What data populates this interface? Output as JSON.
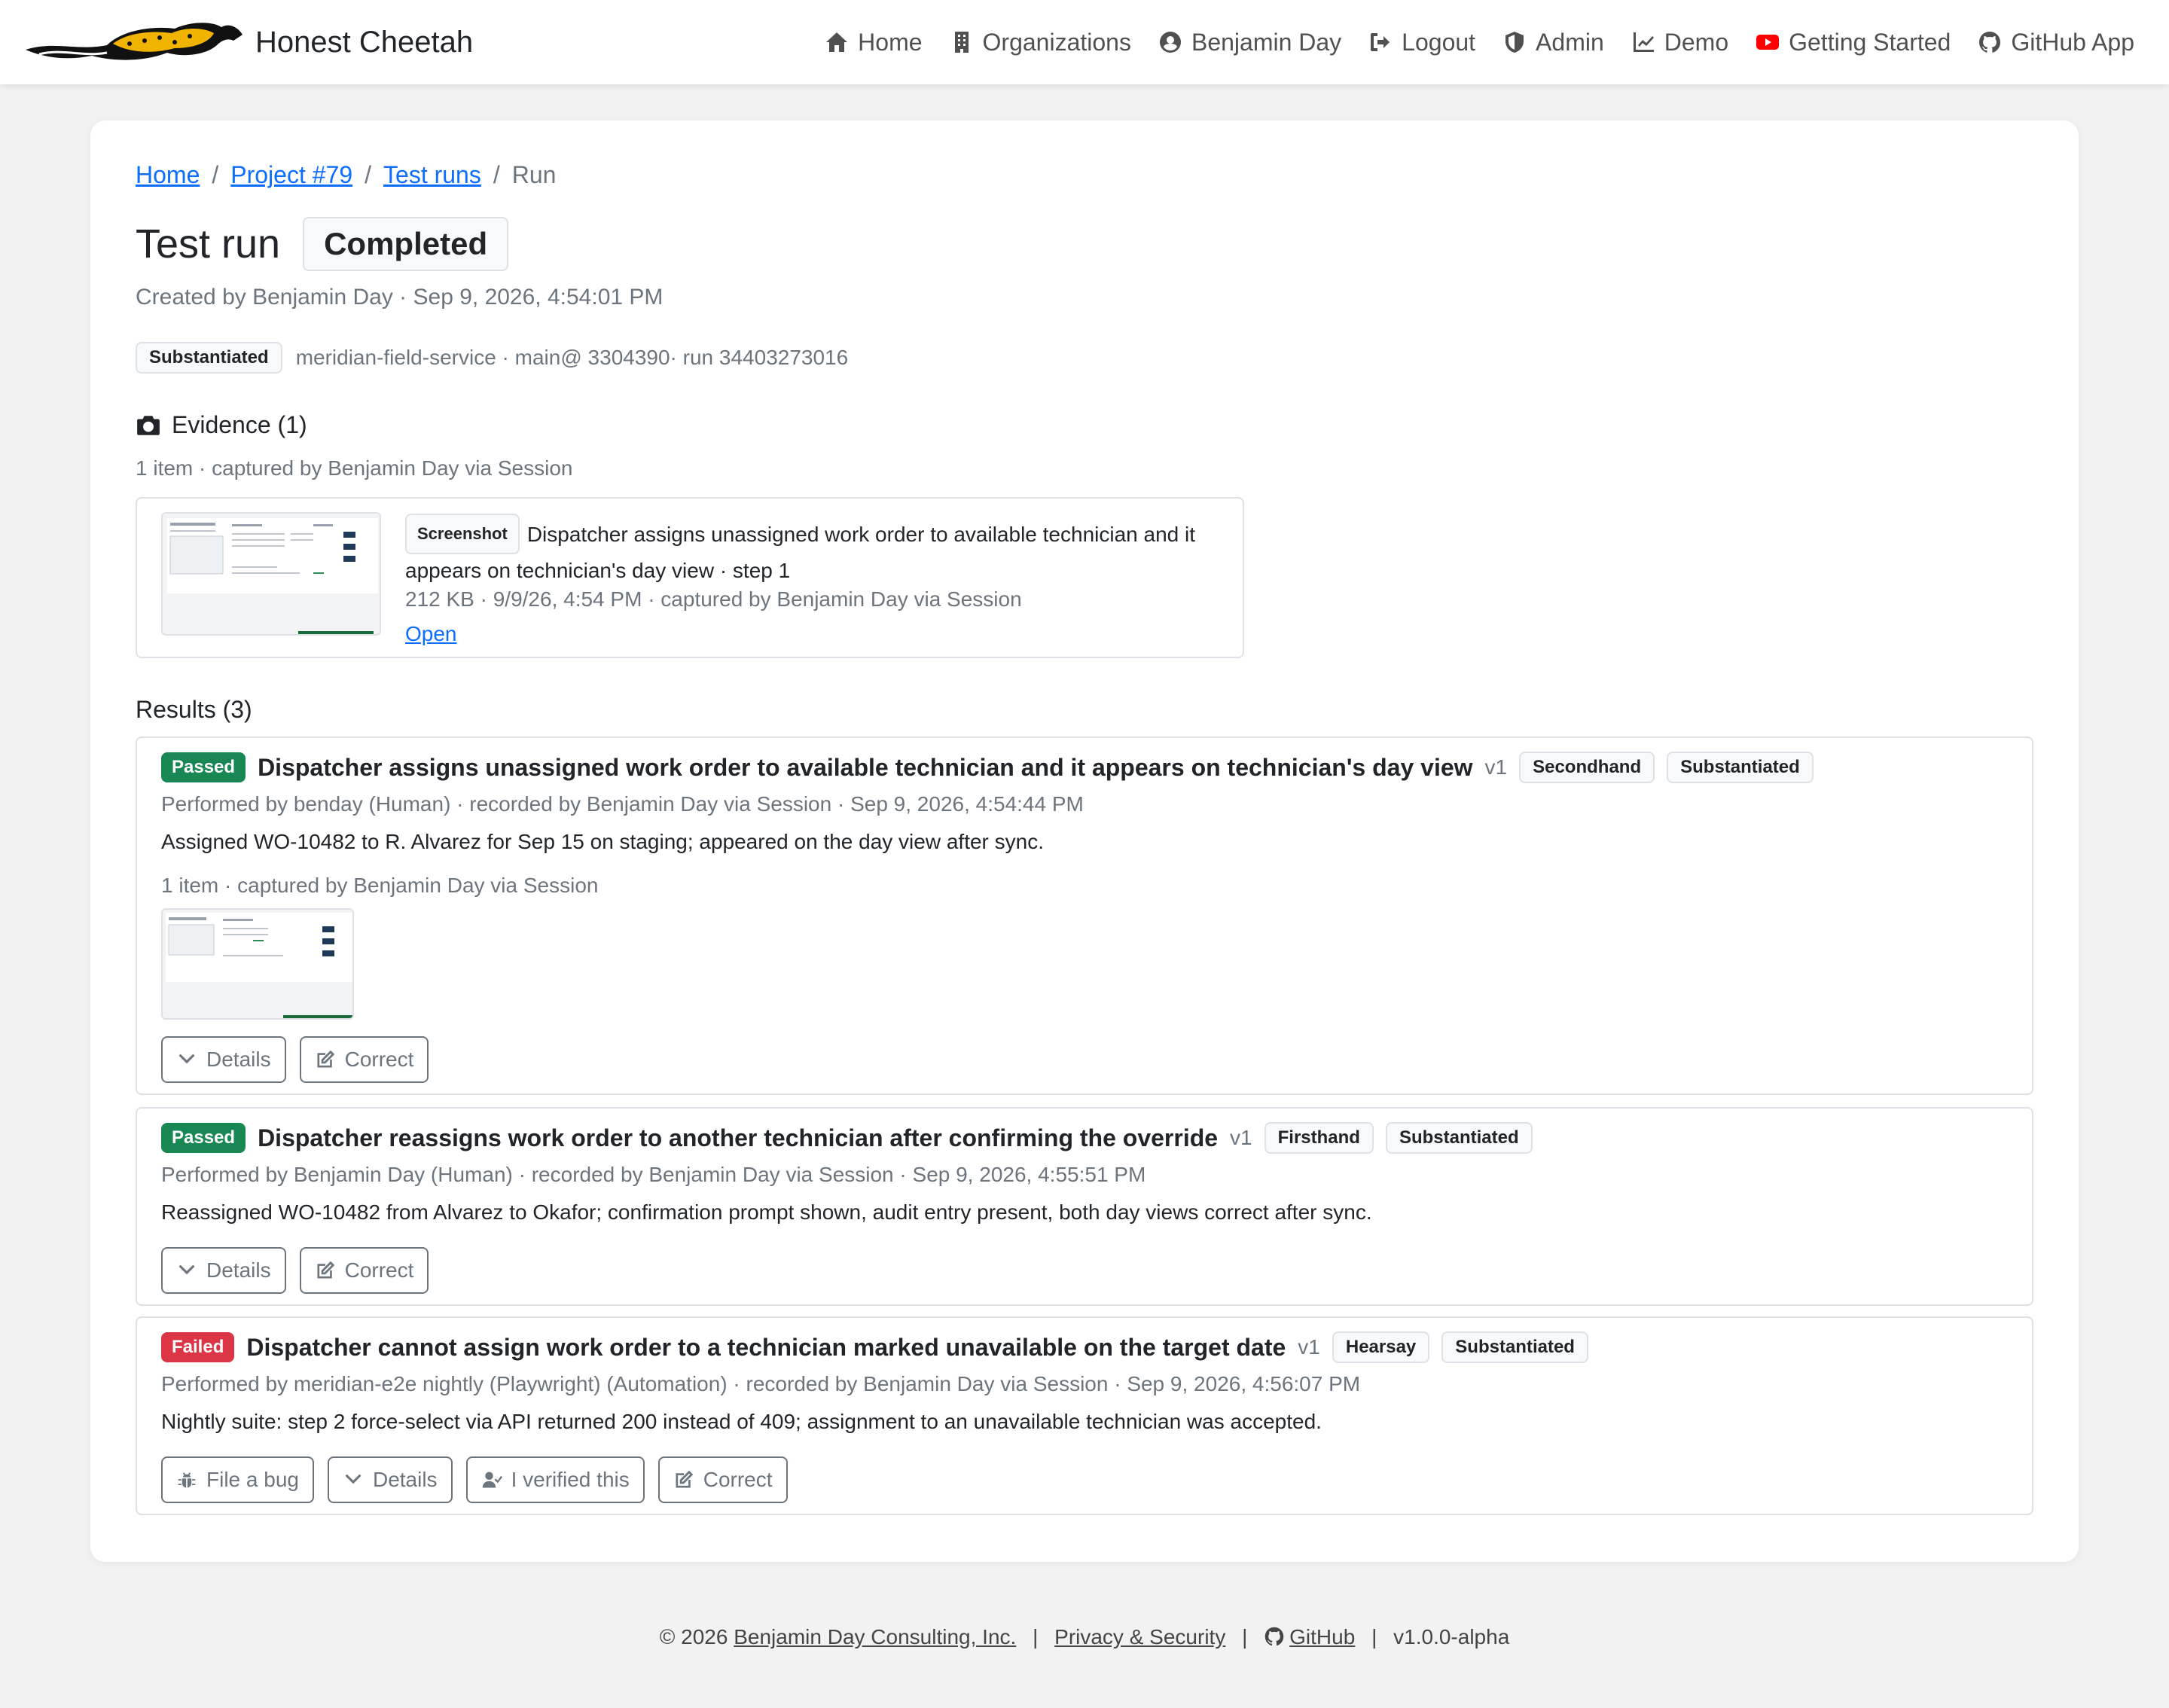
{
  "brand": {
    "name": "Honest Cheetah"
  },
  "nav": {
    "items": [
      {
        "label": "Home",
        "icon": "home-icon"
      },
      {
        "label": "Organizations",
        "icon": "building-icon"
      },
      {
        "label": "Benjamin Day",
        "icon": "user-circle-icon"
      },
      {
        "label": "Logout",
        "icon": "logout-icon"
      },
      {
        "label": "Admin",
        "icon": "shield-icon"
      },
      {
        "label": "Demo",
        "icon": "chart-line-icon"
      },
      {
        "label": "Getting Started",
        "icon": "youtube-icon"
      },
      {
        "label": "GitHub App",
        "icon": "github-icon"
      }
    ]
  },
  "breadcrumb": {
    "home": "Home",
    "project": "Project #79",
    "runs": "Test runs",
    "current": "Run",
    "sep": "/"
  },
  "run": {
    "title": "Test run",
    "status": "Completed",
    "created": "Created by Benjamin Day · Sep 9, 2026, 4:54:01 PM",
    "badge": "Substantiated",
    "meta": "meridian-field-service · main@ 3304390· run 34403273016"
  },
  "evidence": {
    "heading": "Evidence (1)",
    "sub": "1 item · captured by Benjamin Day via Session",
    "item": {
      "type": "Screenshot",
      "title": "Dispatcher assigns unassigned work order to available technician and it appears on technician's day view · step 1",
      "meta": "212 KB · 9/9/26, 4:54 PM · captured by Benjamin Day via Session",
      "open": "Open"
    }
  },
  "results": {
    "heading": "Results (3)",
    "items": [
      {
        "status": "Passed",
        "title": "Dispatcher assigns unassigned work order to available technician and it appears on technician's day view",
        "version": "v1",
        "badges": [
          "Secondhand",
          "Substantiated"
        ],
        "meta": "Performed by benday (Human) · recorded by Benjamin Day via Session · Sep 9, 2026, 4:54:44 PM",
        "summary": "Assigned WO-10482 to R. Alvarez for Sep 15 on staging; appeared on the day view after sync.",
        "evidence_sub": "1 item · captured by Benjamin Day via Session",
        "actions": [
          "Details",
          "Correct"
        ]
      },
      {
        "status": "Passed",
        "title": "Dispatcher reassigns work order to another technician after confirming the override",
        "version": "v1",
        "badges": [
          "Firsthand",
          "Substantiated"
        ],
        "meta": "Performed by Benjamin Day (Human) · recorded by Benjamin Day via Session · Sep 9, 2026, 4:55:51 PM",
        "summary": "Reassigned WO-10482 from Alvarez to Okafor; confirmation prompt shown, audit entry present, both day views correct after sync.",
        "actions": [
          "Details",
          "Correct"
        ]
      },
      {
        "status": "Failed",
        "title": "Dispatcher cannot assign work order to a technician marked unavailable on the target date",
        "version": "v1",
        "badges": [
          "Hearsay",
          "Substantiated"
        ],
        "meta": "Performed by meridian-e2e nightly (Playwright) (Automation) · recorded by Benjamin Day via Session · Sep 9, 2026, 4:56:07 PM",
        "summary": "Nightly suite: step 2 force-select via API returned 200 instead of 409; assignment to an unavailable technician was accepted.",
        "actions": [
          "File a bug",
          "Details",
          "I verified this",
          "Correct"
        ]
      }
    ]
  },
  "footer": {
    "copyright": "© 2026",
    "company": "Benjamin Day Consulting, Inc.",
    "privacy": "Privacy & Security",
    "github": "GitHub",
    "version": "v1.0.0-alpha",
    "sep": "|"
  },
  "colors": {
    "passed": "#198754",
    "failed": "#dc3545",
    "link": "#0d6efd",
    "youtube": "#ff0000",
    "cheetah": "#f0b400"
  }
}
